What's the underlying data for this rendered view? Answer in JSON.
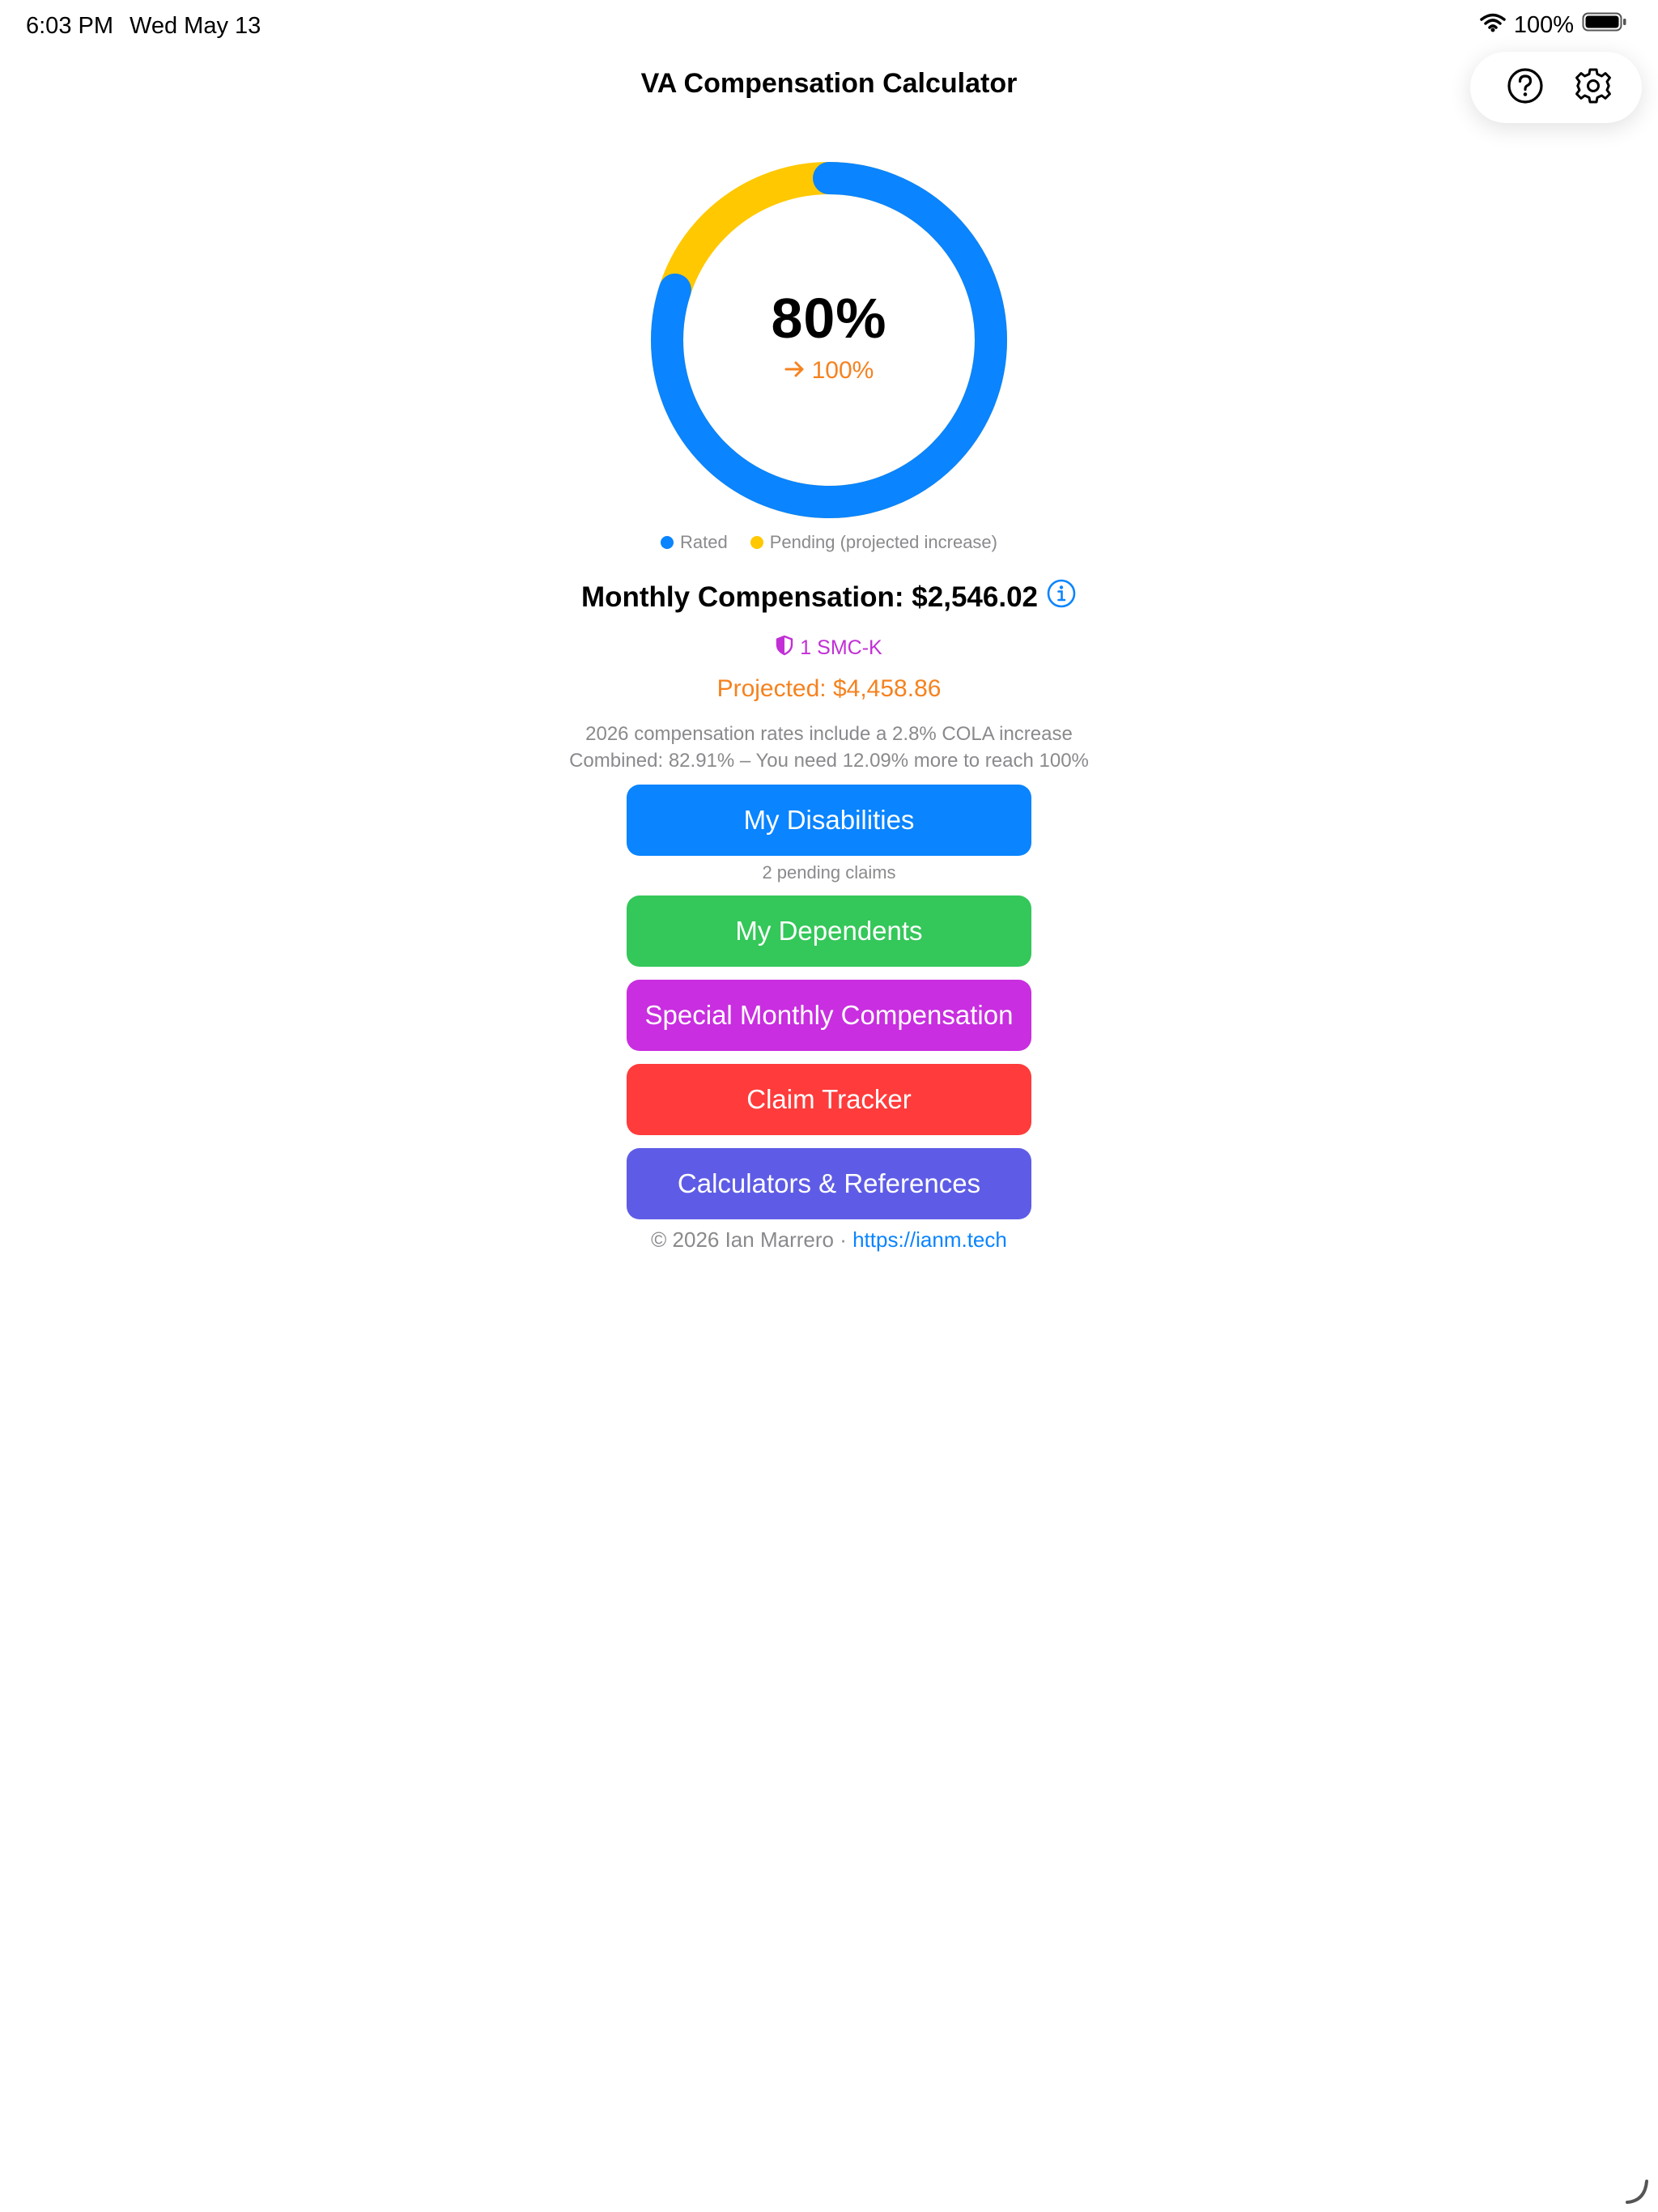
{
  "status_bar": {
    "time": "6:03 PM",
    "date": "Wed May 13",
    "battery": "100%"
  },
  "header": {
    "title": "VA Compensation Calculator",
    "help_icon": "question-circle-icon",
    "settings_icon": "gear-icon"
  },
  "ring": {
    "rated_percent": "80%",
    "projected_percent": "100%",
    "rated_fraction": 0.8,
    "pending_fraction": 0.2,
    "colors": {
      "rated": "#0a84ff",
      "pending": "#ffc800"
    }
  },
  "legend": {
    "rated": "Rated",
    "pending": "Pending (projected increase)"
  },
  "monthly": {
    "label": "Monthly Compensation: $2,546.02",
    "info_icon": "info-circle-icon"
  },
  "smc_badge": "1 SMC-K",
  "projected": "Projected: $4,458.86",
  "notes": {
    "cola": "2026 compensation rates include a 2.8% COLA increase",
    "combined": "Combined: 82.91% – You need 12.09% more to reach 100%"
  },
  "buttons": {
    "disabilities": "My Disabilities",
    "pending_caption": "2 pending claims",
    "dependents": "My Dependents",
    "smc": "Special Monthly Compensation",
    "claim_tracker": "Claim Tracker",
    "calculators": "Calculators & References"
  },
  "button_colors": {
    "disabilities": "#0a84ff",
    "dependents": "#34c759",
    "smc": "#c92ee0",
    "claim_tracker": "#ff3b3b",
    "calculators": "#5e5ce6"
  },
  "footer": {
    "text": "© 2026 Ian Marrero ·",
    "link": "https://ianm.tech"
  }
}
